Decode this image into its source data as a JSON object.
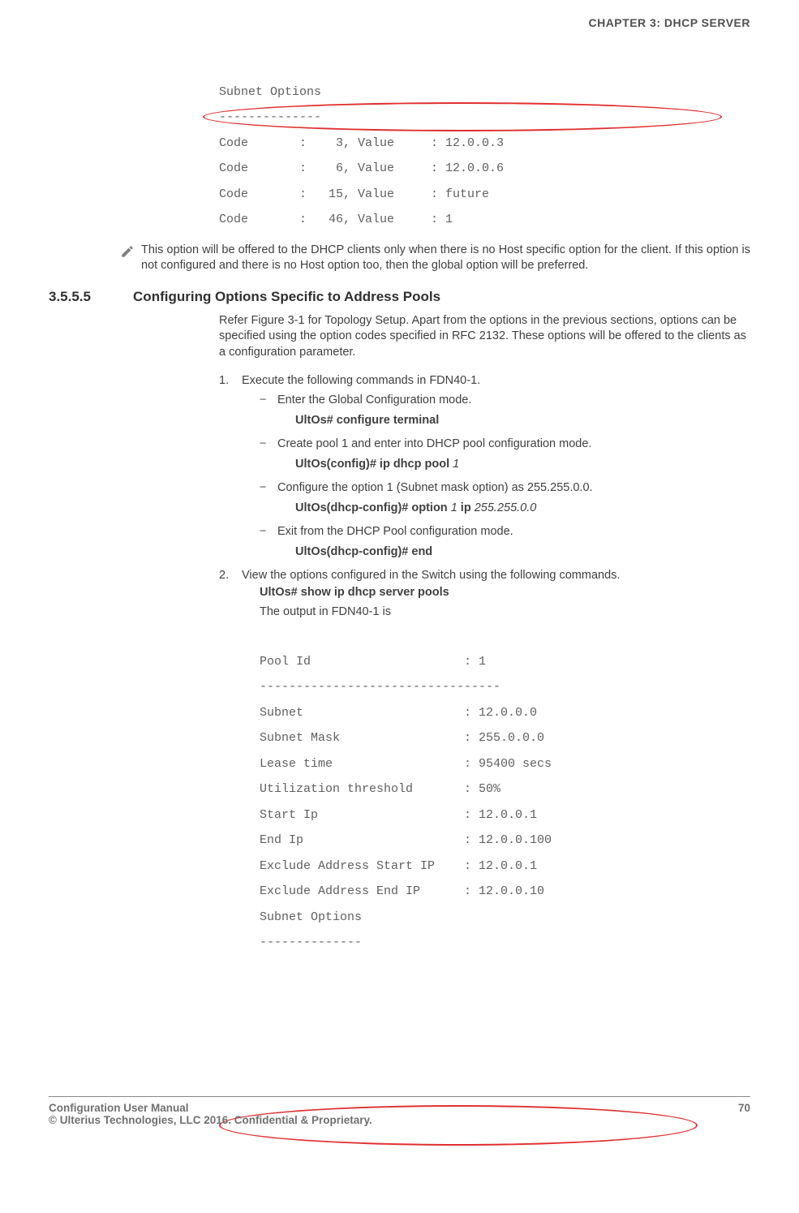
{
  "header": {
    "chapter": "CHAPTER 3: DHCP SERVER"
  },
  "code1": {
    "l1": "Subnet Options",
    "l2": "--------------",
    "l3": "Code       :    3, Value     : 12.0.0.3",
    "l4": "Code       :    6, Value     : 12.0.0.6",
    "l5": "Code       :   15, Value     : future",
    "l6": "Code       :   46, Value     : 1"
  },
  "note": {
    "text": "This option will be offered to the DHCP clients only when there is no Host specific option for the client. If this option is not configured and there is no Host option too, then the global option will be preferred."
  },
  "section": {
    "num": "3.5.5.5",
    "title": "Configuring Options Specific to Address Pools",
    "intro": "Refer Figure 3-1 for Topology Setup. Apart from the options in the previous sections, options can be specified using the option codes specified in RFC 2132. These options will be offered to the clients as a configuration parameter."
  },
  "steps": {
    "s1": "Execute the following commands in FDN40-1.",
    "s1a": "Enter the Global Configuration mode.",
    "s1a_cmd": "UltOs# configure terminal",
    "s1b": "Create pool 1 and enter into DHCP pool configuration mode.",
    "s1b_cmd_pre": "UltOs(config)# ip dhcp pool ",
    "s1b_cmd_arg": "1",
    "s1c": "Configure the option 1 (Subnet mask option) as 255.255.0.0.",
    "s1c_cmd_pre": "UltOs(dhcp-config)# option ",
    "s1c_cmd_arg1": "1",
    "s1c_cmd_mid": " ip ",
    "s1c_cmd_arg2": "255.255.0.0",
    "s1d": "Exit from the DHCP Pool configuration mode.",
    "s1d_cmd": "UltOs(dhcp-config)# end",
    "s2": "View the options configured in the Switch using the following commands.",
    "s2_cmd": "UltOs# show ip dhcp server pools",
    "s2_out": "The output in FDN40-1 is"
  },
  "code2": {
    "l1": "Pool Id                     : 1",
    "l2": "---------------------------------",
    "l3": "Subnet                      : 12.0.0.0",
    "l4": "Subnet Mask                 : 255.0.0.0",
    "l5": "Lease time                  : 95400 secs",
    "l6": "Utilization threshold       : 50%",
    "l7": "Start Ip                    : 12.0.0.1",
    "l8": "End Ip                      : 12.0.0.100",
    "l9": "Exclude Address Start IP    : 12.0.0.1",
    "l10": "Exclude Address End IP      : 12.0.0.10",
    "l11": "Subnet Options",
    "l12": "--------------"
  },
  "footer": {
    "left1": "Configuration User Manual",
    "left2": "© Ulterius Technologies, LLC 2016. Confidential & Proprietary.",
    "page": "70"
  }
}
